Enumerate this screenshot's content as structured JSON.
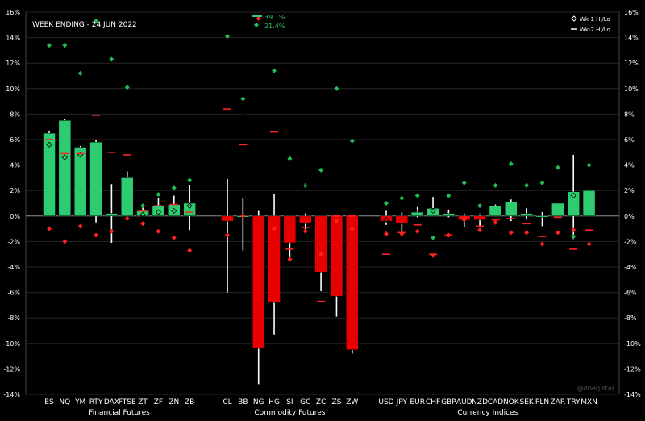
{
  "chart_data": {
    "type": "bar",
    "title": "WEEK ENDING - 24 JUN 2022",
    "watermark": "@dberjistar",
    "ylim": [
      -14,
      16
    ],
    "yticks": [
      -14,
      -12,
      -10,
      -8,
      -6,
      -4,
      -2,
      0,
      2,
      4,
      6,
      8,
      10,
      12,
      14,
      16
    ],
    "ytick_format": "%",
    "legend": {
      "position": "top-right",
      "items": [
        "Wk-1 Hi/Lo",
        "Wk-2 Hi/Lo"
      ]
    },
    "colors": {
      "up": "#2ecc71",
      "down": "#e60000",
      "wk1": "#22bb55",
      "wk2": "#ff2222",
      "range": "#ffffff"
    },
    "callouts": [
      {
        "category": "NG",
        "marker": "Wk-2",
        "value": 39.1,
        "label": "39.1%"
      },
      {
        "category": "NG",
        "marker": "Wk-1",
        "value": 21.4,
        "label": "21.4%"
      }
    ],
    "groups": [
      {
        "name": "Financial Futures",
        "categories": [
          "ES",
          "NQ",
          "YM",
          "RTY",
          "DAX",
          "FTSE",
          "ZT",
          "ZF",
          "ZN",
          "ZB"
        ]
      },
      {
        "name": "Commodity Futures",
        "categories": [
          "CL",
          "BB",
          "NG",
          "HG",
          "SI",
          "GC",
          "ZC",
          "ZS",
          "ZW"
        ]
      },
      {
        "name": "Currency Indices",
        "categories": [
          "USD",
          "JPY",
          "EUR",
          "CHF",
          "GBP",
          "AUD",
          "NZD",
          "CAD",
          "NOK",
          "SEK",
          "PLN",
          "ZAR",
          "TRY",
          "MXN"
        ]
      }
    ],
    "series": [
      {
        "name": "Weekly % change",
        "values": {
          "ES": 6.5,
          "NQ": 7.5,
          "YM": 5.4,
          "RTY": 5.8,
          "DAX": 0.2,
          "FTSE": 3.0,
          "ZT": 0.4,
          "ZF": 0.8,
          "ZN": 0.9,
          "ZB": 1.0,
          "CL": -0.4,
          "BB": 0.0,
          "NG": -10.4,
          "HG": -6.8,
          "SI": -2.1,
          "GC": -0.6,
          "ZC": -4.4,
          "ZS": -6.3,
          "ZW": -10.5,
          "USD": -0.4,
          "JPY": -0.6,
          "EUR": 0.3,
          "CHF": 0.6,
          "GBP": 0.2,
          "AUD": -0.3,
          "NZD": -0.3,
          "CAD": 0.8,
          "NOK": 1.1,
          "SEK": 0.2,
          "PLN": 0.0,
          "ZAR": 1.0,
          "TRY": 1.9,
          "MXN": 2.0
        }
      },
      {
        "name": "Weekly Hi/Lo",
        "values": {
          "ES": [
            6.7,
            0.0
          ],
          "NQ": [
            7.6,
            0.0
          ],
          "YM": [
            5.5,
            0.0
          ],
          "RTY": [
            6.0,
            -0.5
          ],
          "DAX": [
            2.5,
            -2.1
          ],
          "FTSE": [
            3.5,
            0.0
          ],
          "ZT": [
            0.7,
            0.0
          ],
          "ZF": [
            1.4,
            0.0
          ],
          "ZN": [
            1.6,
            0.0
          ],
          "ZB": [
            2.4,
            -1.1
          ],
          "CL": [
            2.9,
            -6.0
          ],
          "BB": [
            1.4,
            -2.7
          ],
          "NG": [
            0.4,
            -13.2
          ],
          "HG": [
            1.7,
            -9.3
          ],
          "SI": [
            0.0,
            -3.5
          ],
          "GC": [
            0.2,
            -1.3
          ],
          "ZC": [
            0.0,
            -5.9
          ],
          "ZS": [
            0.0,
            -7.9
          ],
          "ZW": [
            0.0,
            -10.8
          ],
          "USD": [
            0.4,
            -0.7
          ],
          "JPY": [
            0.3,
            -1.6
          ],
          "EUR": [
            0.7,
            -0.1
          ],
          "CHF": [
            1.5,
            0.0
          ],
          "GBP": [
            0.5,
            -0.1
          ],
          "AUD": [
            0.2,
            -0.9
          ],
          "NZD": [
            0.2,
            -0.8
          ],
          "CAD": [
            0.9,
            0.0
          ],
          "NOK": [
            1.3,
            -0.4
          ],
          "SEK": [
            0.6,
            -0.2
          ],
          "PLN": [
            0.3,
            -0.8
          ],
          "ZAR": [
            1.0,
            0.0
          ],
          "TRY": [
            4.8,
            -1.8
          ],
          "MXN": [
            2.1,
            0.0
          ]
        }
      },
      {
        "name": "Wk-1 Hi/Lo",
        "values": {
          "ES": [
            13.4,
            5.6
          ],
          "NQ": [
            13.4,
            4.6
          ],
          "YM": [
            11.2,
            4.8
          ],
          "RTY": [
            15.3,
            7.7
          ],
          "DAX": [
            12.3,
            4.4
          ],
          "FTSE": [
            10.1,
            5.5
          ],
          "ZT": [
            0.8,
            0.1
          ],
          "ZF": [
            1.7,
            0.3
          ],
          "ZN": [
            2.2,
            0.4
          ],
          "ZB": [
            2.8,
            0.8
          ],
          "CL": [
            14.1,
            14.5
          ],
          "BB": [
            9.2,
            8.1
          ],
          "NG": [
            21.4,
            21.4
          ],
          "HG": [
            11.4,
            6.5
          ],
          "SI": [
            4.5,
            2.1
          ],
          "GC": [
            2.4,
            2.3
          ],
          "ZC": [
            3.6,
            2.0
          ],
          "ZS": [
            10.0,
            8.3
          ],
          "ZW": [
            5.9,
            4.7
          ],
          "USD": [
            1.0,
            -0.3
          ],
          "JPY": [
            1.4,
            2.3
          ],
          "EUR": [
            1.6,
            0.6
          ],
          "CHF": [
            -1.7,
            0.4
          ],
          "GBP": [
            1.6,
            0.8
          ],
          "AUD": [
            2.6,
            1.6
          ],
          "NZD": [
            0.8,
            0.3
          ],
          "CAD": [
            2.4,
            1.9
          ],
          "NOK": [
            4.1,
            2.3
          ],
          "SEK": [
            2.4,
            1.3
          ],
          "PLN": [
            2.6,
            1.3
          ],
          "ZAR": [
            3.8,
            1.8
          ],
          "TRY": [
            -1.6,
            1.6
          ],
          "MXN": [
            4.0,
            2.5
          ]
        }
      },
      {
        "name": "Wk-2 Hi/Lo",
        "values": {
          "ES": [
            6.0,
            -1.0
          ],
          "NQ": [
            4.9,
            -2.0
          ],
          "YM": [
            4.9,
            -0.8
          ],
          "RTY": [
            7.9,
            -1.5
          ],
          "DAX": [
            5.0,
            -1.2
          ],
          "FTSE": [
            4.8,
            -0.2
          ],
          "ZT": [
            0.4,
            -0.6
          ],
          "ZF": [
            0.8,
            -1.2
          ],
          "ZN": [
            0.9,
            -1.7
          ],
          "ZB": [
            0.3,
            -2.7
          ],
          "CL": [
            8.4,
            -1.5
          ],
          "BB": [
            5.6,
            0.0
          ],
          "NG": [
            39.1,
            15.5
          ],
          "HG": [
            6.6,
            -1.0
          ],
          "SI": [
            -2.6,
            -3.4
          ],
          "GC": [
            -0.9,
            -1.2
          ],
          "ZC": [
            -6.7,
            -3.0
          ],
          "ZS": [
            0.0,
            -0.4
          ],
          "ZW": [
            0.0,
            -1.0
          ],
          "USD": [
            -3.0,
            -1.4
          ],
          "JPY": [
            -1.3,
            -1.4
          ],
          "EUR": [
            -0.7,
            -1.2
          ],
          "CHF": [
            -3.0,
            -3.1
          ],
          "GBP": [
            -1.5,
            -1.5
          ],
          "AUD": [
            -0.1,
            -0.3
          ],
          "NZD": [
            -0.8,
            -1.1
          ],
          "CAD": [
            -0.3,
            -0.5
          ],
          "NOK": [
            -0.2,
            -1.3
          ],
          "SEK": [
            -0.6,
            -1.3
          ],
          "PLN": [
            -1.6,
            -2.2
          ],
          "ZAR": [
            -0.1,
            -1.3
          ],
          "TRY": [
            -2.6,
            -1.1
          ],
          "MXN": [
            -1.1,
            -2.2
          ]
        }
      }
    ]
  }
}
